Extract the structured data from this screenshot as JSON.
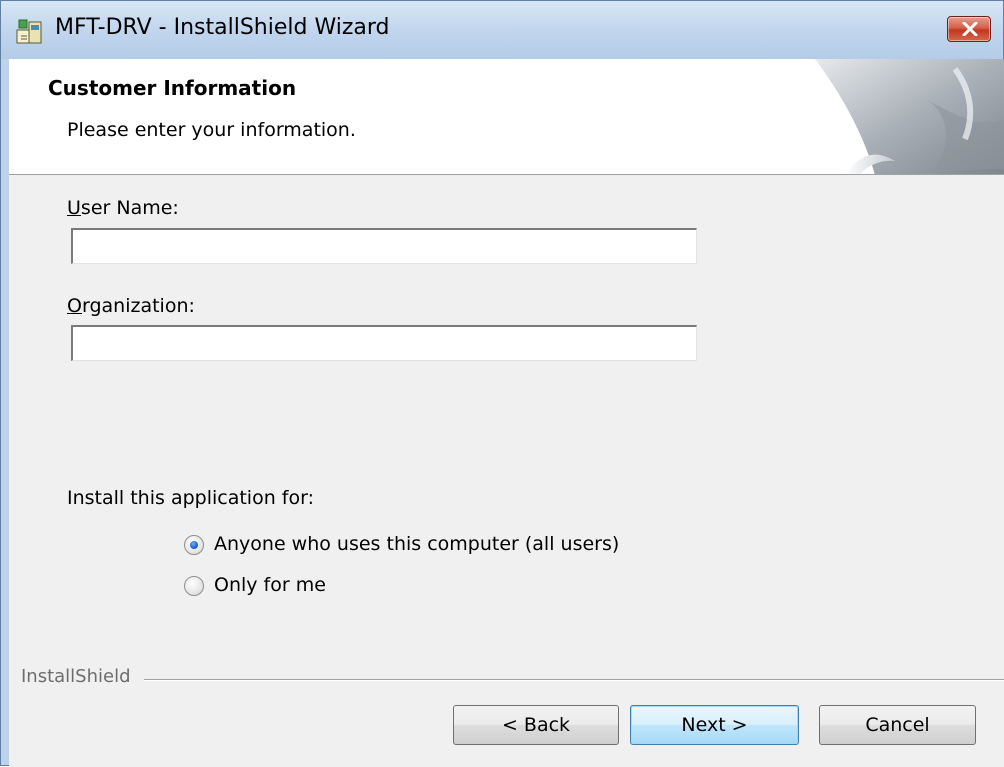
{
  "window": {
    "title": "MFT-DRV - InstallShield Wizard",
    "close_glyph": "✕"
  },
  "banner": {
    "title": "Customer Information",
    "subtitle": "Please enter your information."
  },
  "form": {
    "user_name": {
      "label_accel": "U",
      "label_rest": "ser Name:",
      "value": ""
    },
    "organization": {
      "label_accel": "O",
      "label_rest": "rganization:",
      "value": ""
    },
    "install_for_label": "Install this application for:",
    "options": [
      {
        "label": "Anyone who uses this computer (all users)",
        "selected": true
      },
      {
        "label": "Only for me",
        "selected": false
      }
    ]
  },
  "footer": {
    "brand": "InstallShield",
    "back_label": "< Back",
    "next_label": "Next >",
    "cancel_label": "Cancel"
  },
  "colors": {
    "accent": "#3c7fb1",
    "close": "#c2361f",
    "dialog_bg": "#f0f0f0"
  }
}
